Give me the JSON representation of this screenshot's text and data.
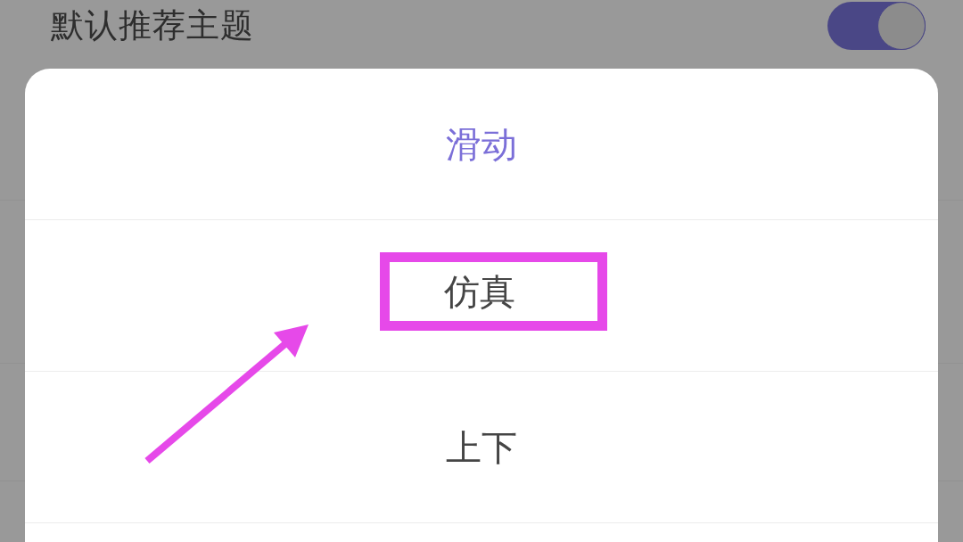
{
  "setting": {
    "label": "默认推荐主题",
    "on": true
  },
  "sheet": {
    "options": [
      {
        "label": "滑动",
        "selected": true,
        "highlighted": false
      },
      {
        "label": "仿真",
        "selected": false,
        "highlighted": true
      },
      {
        "label": "上下",
        "selected": false,
        "highlighted": false
      }
    ]
  }
}
